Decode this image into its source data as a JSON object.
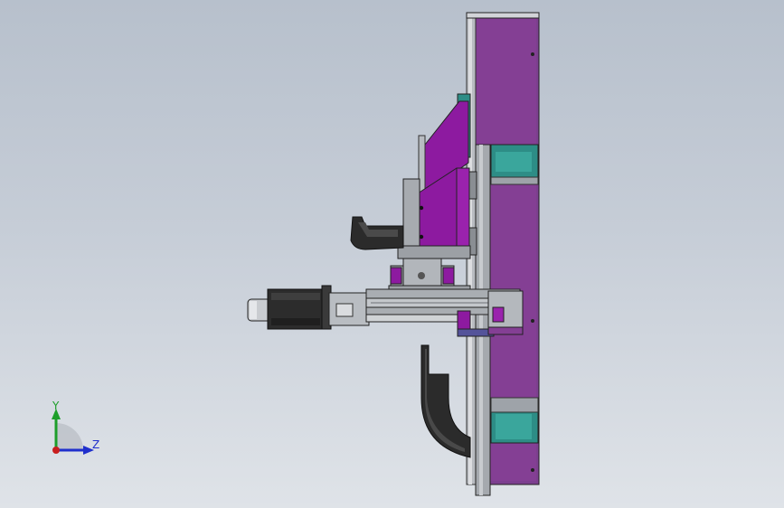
{
  "viewport": {
    "background_top": "#b7c0cc",
    "background_bottom": "#dfe3e8"
  },
  "model": {
    "primary_color": "#843f94",
    "magenta_color": "#8d1aa0",
    "teal_color": "#2d8d86",
    "steel_color": "#9fa4aa",
    "dark_color": "#2b2b2b"
  },
  "triad": {
    "y_label": "Y",
    "z_label": "Z",
    "y_color": "#1d9e2a",
    "z_color": "#1f2fcc",
    "x_color": "#c81e1e"
  }
}
